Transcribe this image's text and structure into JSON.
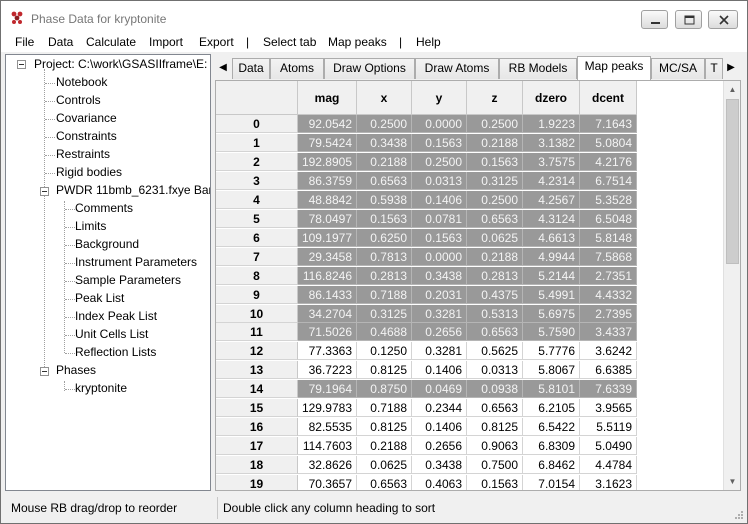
{
  "window": {
    "title": "Phase Data for kryptonite",
    "controls": {
      "minimize": "minimize-icon",
      "maximize": "maximize-icon",
      "close": "close-icon"
    }
  },
  "menu": [
    "File",
    "Data",
    "Calculate",
    "Import",
    "Export",
    "|",
    "Select tab",
    "Map peaks",
    "|",
    "Help"
  ],
  "tree": {
    "project": "Project: C:\\work\\GSASIIframe\\E:",
    "items": [
      "Notebook",
      "Controls",
      "Covariance",
      "Constraints",
      "Restraints",
      "Rigid bodies"
    ],
    "pwdr": "PWDR 11bmb_6231.fxye Ban",
    "pwdr_items": [
      "Comments",
      "Limits",
      "Background",
      "Instrument Parameters",
      "Sample Parameters",
      "Peak List",
      "Index Peak List",
      "Unit Cells List",
      "Reflection Lists"
    ],
    "phases": "Phases",
    "phase_items": [
      "kryptonite"
    ]
  },
  "tabs": [
    "Data",
    "Atoms",
    "Draw Options",
    "Draw Atoms",
    "RB Models",
    "Map peaks",
    "MC/SA",
    "T"
  ],
  "active_tab": "Map peaks",
  "table": {
    "columns": [
      "mag",
      "x",
      "y",
      "z",
      "dzero",
      "dcent"
    ],
    "rows": [
      {
        "id": "0",
        "mag": "92.0542",
        "x": "0.2500",
        "y": "0.0000",
        "z": "0.2500",
        "dzero": "1.9223",
        "dcent": "7.1643",
        "selected": true
      },
      {
        "id": "1",
        "mag": "79.5424",
        "x": "0.3438",
        "y": "0.1563",
        "z": "0.2188",
        "dzero": "3.1382",
        "dcent": "5.0804",
        "selected": true
      },
      {
        "id": "2",
        "mag": "192.8905",
        "x": "0.2188",
        "y": "0.2500",
        "z": "0.1563",
        "dzero": "3.7575",
        "dcent": "4.2176",
        "selected": true
      },
      {
        "id": "3",
        "mag": "86.3759",
        "x": "0.6563",
        "y": "0.0313",
        "z": "0.3125",
        "dzero": "4.2314",
        "dcent": "6.7514",
        "selected": true
      },
      {
        "id": "4",
        "mag": "48.8842",
        "x": "0.5938",
        "y": "0.1406",
        "z": "0.2500",
        "dzero": "4.2567",
        "dcent": "5.3528",
        "selected": true
      },
      {
        "id": "5",
        "mag": "78.0497",
        "x": "0.1563",
        "y": "0.0781",
        "z": "0.6563",
        "dzero": "4.3124",
        "dcent": "6.5048",
        "selected": true
      },
      {
        "id": "6",
        "mag": "109.1977",
        "x": "0.6250",
        "y": "0.1563",
        "z": "0.0625",
        "dzero": "4.6613",
        "dcent": "5.8148",
        "selected": true
      },
      {
        "id": "7",
        "mag": "29.3458",
        "x": "0.7813",
        "y": "0.0000",
        "z": "0.2188",
        "dzero": "4.9944",
        "dcent": "7.5868",
        "selected": true
      },
      {
        "id": "8",
        "mag": "116.8246",
        "x": "0.2813",
        "y": "0.3438",
        "z": "0.2813",
        "dzero": "5.2144",
        "dcent": "2.7351",
        "selected": true
      },
      {
        "id": "9",
        "mag": "86.1433",
        "x": "0.7188",
        "y": "0.2031",
        "z": "0.4375",
        "dzero": "5.4991",
        "dcent": "4.4332",
        "selected": true
      },
      {
        "id": "10",
        "mag": "34.2704",
        "x": "0.3125",
        "y": "0.3281",
        "z": "0.5313",
        "dzero": "5.6975",
        "dcent": "2.7395",
        "selected": true
      },
      {
        "id": "11",
        "mag": "71.5026",
        "x": "0.4688",
        "y": "0.2656",
        "z": "0.6563",
        "dzero": "5.7590",
        "dcent": "3.4337",
        "selected": true
      },
      {
        "id": "12",
        "mag": "77.3363",
        "x": "0.1250",
        "y": "0.3281",
        "z": "0.5625",
        "dzero": "5.7776",
        "dcent": "3.6242",
        "selected": false
      },
      {
        "id": "13",
        "mag": "36.7223",
        "x": "0.8125",
        "y": "0.1406",
        "z": "0.0313",
        "dzero": "5.8067",
        "dcent": "6.6385",
        "selected": false
      },
      {
        "id": "14",
        "mag": "79.1964",
        "x": "0.8750",
        "y": "0.0469",
        "z": "0.0938",
        "dzero": "5.8101",
        "dcent": "7.6339",
        "selected": true
      },
      {
        "id": "15",
        "mag": "129.9783",
        "x": "0.7188",
        "y": "0.2344",
        "z": "0.6563",
        "dzero": "6.2105",
        "dcent": "3.9565",
        "selected": false
      },
      {
        "id": "16",
        "mag": "82.5535",
        "x": "0.8125",
        "y": "0.1406",
        "z": "0.8125",
        "dzero": "6.5422",
        "dcent": "5.5119",
        "selected": false
      },
      {
        "id": "17",
        "mag": "114.7603",
        "x": "0.2188",
        "y": "0.2656",
        "z": "0.9063",
        "dzero": "6.8309",
        "dcent": "5.0490",
        "selected": false
      },
      {
        "id": "18",
        "mag": "32.8626",
        "x": "0.0625",
        "y": "0.3438",
        "z": "0.7500",
        "dzero": "6.8462",
        "dcent": "4.4784",
        "selected": false
      },
      {
        "id": "19",
        "mag": "70.3657",
        "x": "0.6563",
        "y": "0.4063",
        "z": "0.1563",
        "dzero": "7.0154",
        "dcent": "3.1623",
        "selected": false
      }
    ]
  },
  "status": {
    "left": "Mouse RB drag/drop to reorder",
    "right": "Double click any column heading to sort"
  },
  "colors": {
    "selected_cell": "#999999",
    "header": "#f0f0f0"
  }
}
